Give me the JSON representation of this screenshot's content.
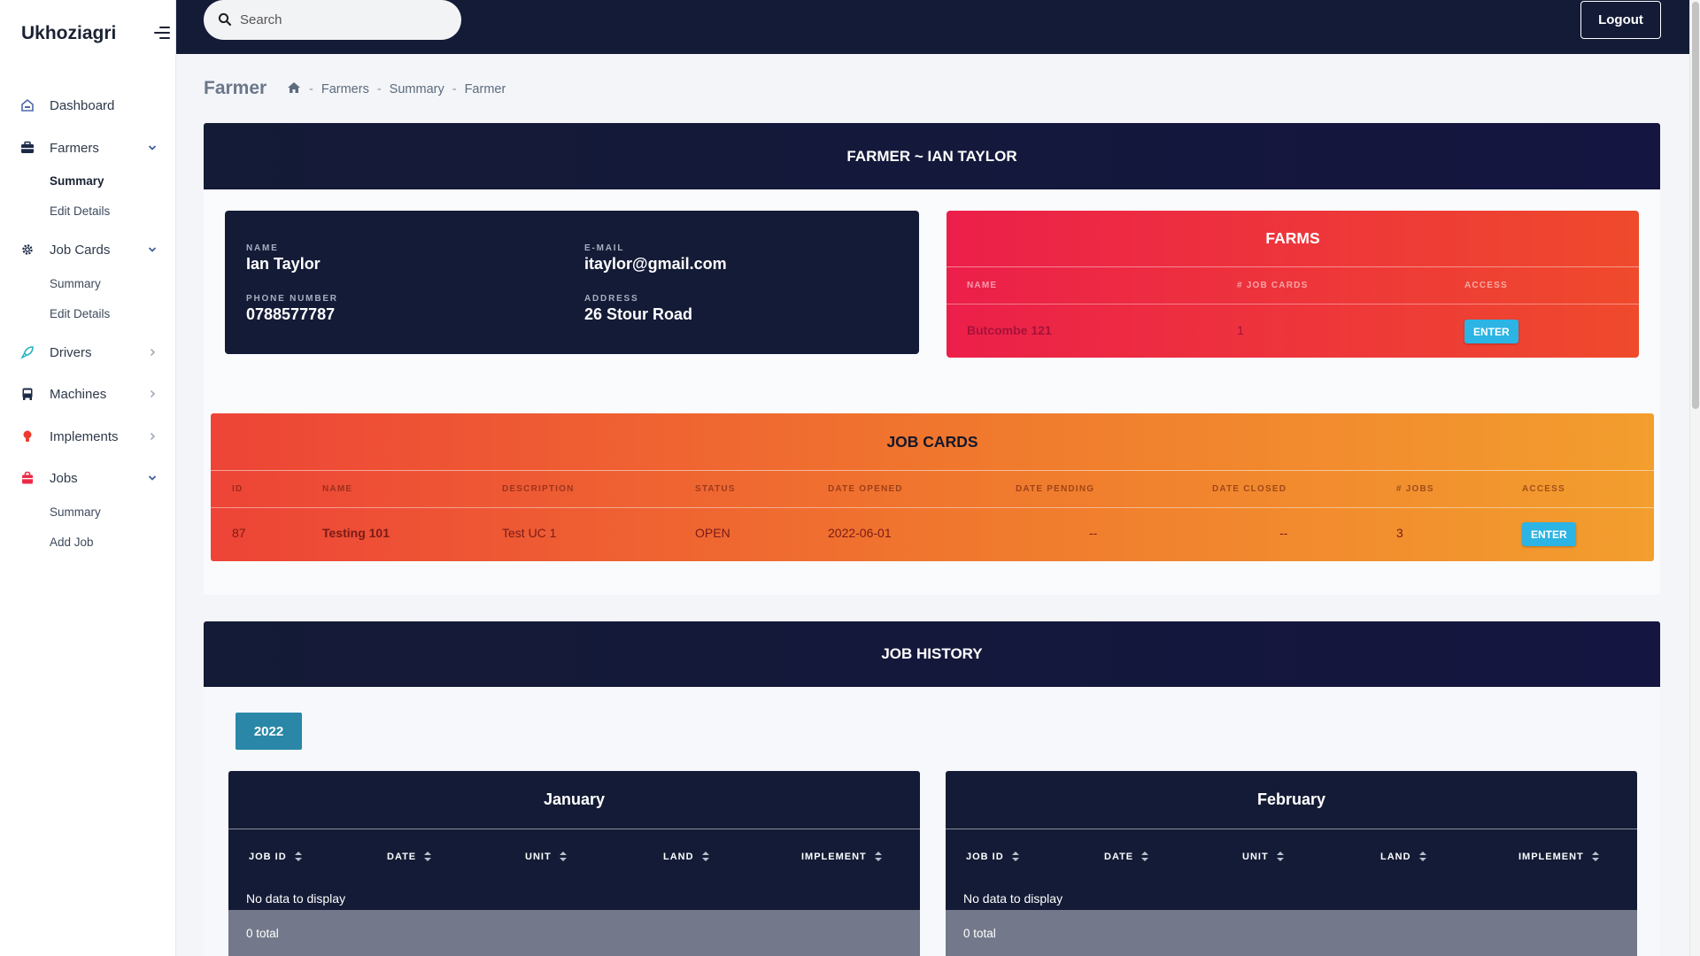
{
  "app": {
    "brand": "Ukhoziagri"
  },
  "search": {
    "placeholder": "Search"
  },
  "topbar": {
    "logout_label": "Logout"
  },
  "sidebar": {
    "items": [
      {
        "label": "Dashboard",
        "icon": "dashboard-icon"
      },
      {
        "label": "Farmers",
        "icon": "briefcase-icon",
        "expanded": true,
        "sub": [
          "Summary",
          "Edit Details"
        ]
      },
      {
        "label": "Job Cards",
        "icon": "gear-icon",
        "expanded": true,
        "sub": [
          "Summary",
          "Edit Details"
        ]
      },
      {
        "label": "Drivers",
        "icon": "rocket-icon"
      },
      {
        "label": "Machines",
        "icon": "bus-icon"
      },
      {
        "label": "Implements",
        "icon": "bulb-icon"
      },
      {
        "label": "Jobs",
        "icon": "bag-icon",
        "expanded": true,
        "sub": [
          "Summary",
          "Add Job"
        ]
      }
    ]
  },
  "page": {
    "title": "Farmer",
    "breadcrumb": [
      "Farmers",
      "Summary",
      "Farmer"
    ],
    "panel_title": "FARMER ~ IAN TAYLOR"
  },
  "farmer": {
    "name_label": "NAME",
    "name": "Ian Taylor",
    "email_label": "E-MAIL",
    "email": "itaylor@gmail.com",
    "phone_label": "PHONE NUMBER",
    "phone": "0788577787",
    "address_label": "ADDRESS",
    "address": "26 Stour Road"
  },
  "farms": {
    "title": "FARMS",
    "columns": [
      "NAME",
      "# JOB CARDS",
      "ACCESS"
    ],
    "rows": [
      {
        "name": "Butcombe 121",
        "job_cards": "1",
        "access": "ENTER"
      }
    ]
  },
  "job_cards": {
    "title": "JOB CARDS",
    "columns": [
      "ID",
      "NAME",
      "DESCRIPTION",
      "STATUS",
      "DATE OPENED",
      "DATE PENDING",
      "DATE CLOSED",
      "# JOBS",
      "ACCESS"
    ],
    "rows": [
      {
        "id": "87",
        "name": "Testing 101",
        "description": "Test UC 1",
        "status": "OPEN",
        "date_opened": "2022-06-01",
        "date_pending": "--",
        "date_closed": "--",
        "jobs": "3",
        "access": "ENTER"
      }
    ]
  },
  "job_history": {
    "title": "JOB HISTORY",
    "year": "2022",
    "columns": [
      "JOB ID",
      "DATE",
      "UNIT",
      "LAND",
      "IMPLEMENT"
    ],
    "months": [
      {
        "name": "January",
        "empty": "No data to display",
        "total": "0 total"
      },
      {
        "name": "February",
        "empty": "No data to display",
        "total": "0 total"
      }
    ]
  },
  "colors": {
    "navy": "#141b36",
    "farms_gradient": [
      "#ec1f4a",
      "#ef4a2c"
    ],
    "jobcards_gradient": [
      "#ed4437",
      "#f39e2e"
    ],
    "enter_button": "#2bb4e4",
    "year_button": "#2a87a8"
  }
}
